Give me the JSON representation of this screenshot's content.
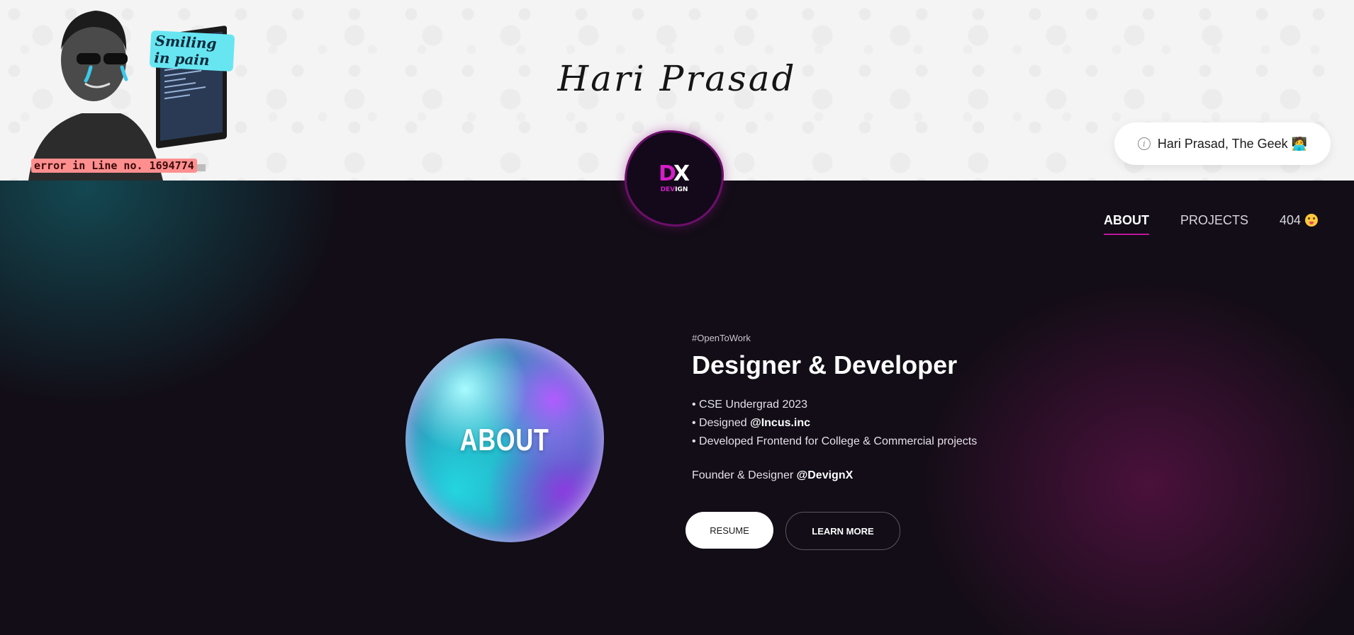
{
  "header": {
    "title": "Hari Prasad",
    "portrait_caption": "Smiling in pain",
    "error_text": "error in Line no. 1694774",
    "info_pill": "Hari Prasad, The Geek 🧑‍💻"
  },
  "logo": {
    "mark_d": "D",
    "mark_x": "X",
    "text_pink": "DEV",
    "text_white": "IGN"
  },
  "nav": {
    "items": [
      {
        "label": "ABOUT",
        "active": true
      },
      {
        "label": "PROJECTS",
        "active": false
      },
      {
        "label": "404",
        "active": false
      }
    ]
  },
  "about": {
    "blob_label": "ABOUT",
    "hashtag": "#OpenToWork",
    "headline": "Designer & Developer",
    "bullet1": "• CSE Undergrad 2023",
    "bullet2_prefix": "• Designed ",
    "bullet2_strong": "@Incus.inc",
    "bullet3": "• Developed Frontend for College & Commercial projects",
    "founder_prefix": "Founder & Designer ",
    "founder_strong": "@DevignX"
  },
  "buttons": {
    "resume": "RESUME",
    "learn_more": "LEARN MORE"
  },
  "colors": {
    "accent_pink": "#c0159f",
    "dark_bg": "#120d16",
    "teal_glow": "#14787f"
  }
}
